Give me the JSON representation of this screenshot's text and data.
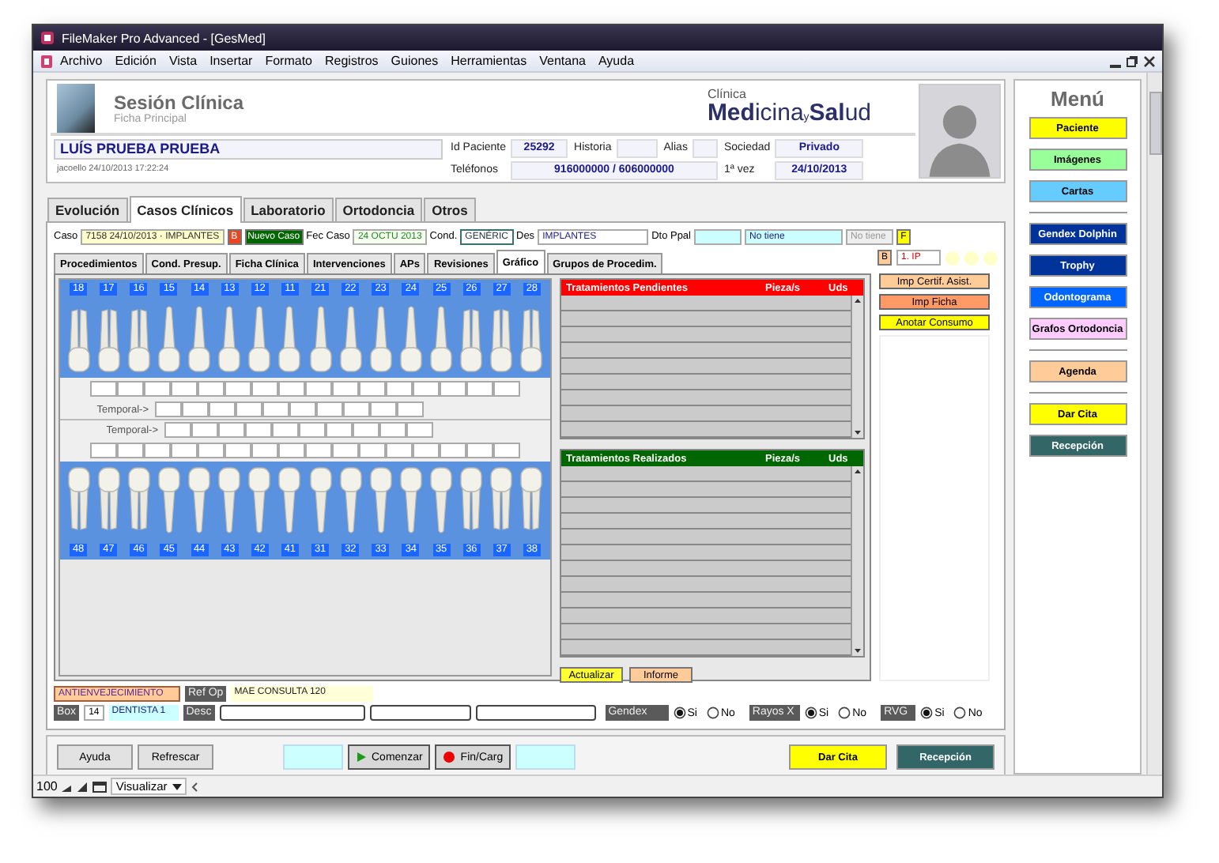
{
  "window": {
    "title": "FileMaker Pro Advanced - [GesMed]"
  },
  "menu_bar": [
    "Archivo",
    "Edición",
    "Vista",
    "Insertar",
    "Formato",
    "Registros",
    "Guiones",
    "Herramientas",
    "Ventana",
    "Ayuda"
  ],
  "header": {
    "title": "Sesión Clínica",
    "subtitle": "Ficha Principal",
    "clinic_label": "Clínica",
    "clinic_name": "**Med**icina$_{y}$**Sal**ud",
    "patient_name": "LUÍS PRUEBA PRUEBA",
    "audit": "jacoello 24/10/2013 17:22:24",
    "fields": [
      {
        "label": "Id Paciente",
        "value": "25292"
      },
      {
        "label": "Historia"
      },
      {
        "label": "Alias"
      },
      {
        "label": "Sociedad",
        "value": "Privado"
      },
      {
        "label": "Teléfonos",
        "value": "916000000 / 606000000"
      },
      {
        "label": "1ª vez",
        "value": "24/10/2013"
      }
    ]
  },
  "tabs": [
    {
      "label": "Evolución",
      "selected": false
    },
    {
      "label": "Casos Clínicos",
      "selected": true
    },
    {
      "label": "Laboratorio",
      "selected": false
    },
    {
      "label": "Ortodoncia",
      "selected": false
    },
    {
      "label": "Otros",
      "selected": false
    }
  ],
  "case": {
    "caso_label": "Caso",
    "caso": "7158 24/10/2013 · IMPLANTES",
    "b_button": "B",
    "new_case_button": "Nuevo Caso",
    "date_label": "Fec Caso",
    "date": "24 OCTU 2013",
    "cond_label": "Cond.",
    "cond": "GENÉRIC",
    "des_label": "Des",
    "des": "IMPLANTES",
    "dto_label": "Dto Ppal",
    "dto_value": "No tiene",
    "dto_status": "No tiene",
    "f_button": "F",
    "subtabs": [
      {
        "label": "Procedimientos",
        "selected": false
      },
      {
        "label": "Cond. Presup.",
        "selected": false
      },
      {
        "label": "Ficha Clínica",
        "selected": false
      },
      {
        "label": "Intervenciones",
        "selected": false
      },
      {
        "label": "APs",
        "selected": false
      },
      {
        "label": "Revisiones",
        "selected": false
      },
      {
        "label": "Gráfico",
        "selected": true
      },
      {
        "label": "Grupos de Procedim.",
        "selected": false
      }
    ],
    "flag_button": "B",
    "ip": "1. IP"
  },
  "odontogram": {
    "upper": [
      "18",
      "17",
      "16",
      "15",
      "14",
      "13",
      "12",
      "11",
      "21",
      "22",
      "23",
      "24",
      "25",
      "26",
      "27",
      "28"
    ],
    "lower": [
      "48",
      "47",
      "46",
      "45",
      "44",
      "43",
      "42",
      "41",
      "31",
      "32",
      "33",
      "34",
      "35",
      "36",
      "37",
      "38"
    ],
    "temporal_labels": [
      "Temporal->",
      "Temporal->"
    ]
  },
  "treatments": [
    {
      "kind": "pending",
      "title": "Tratamientos Pendientes",
      "columns": [
        "Pieza/s",
        "Uds"
      ]
    },
    {
      "kind": "done",
      "title": "Tratamientos Realizados",
      "columns": [
        "Pieza/s",
        "Uds"
      ]
    }
  ],
  "treatment_buttons": [
    {
      "label": "Actualizar",
      "color": "#ffff33"
    },
    {
      "label": "Informe",
      "color": "#ffcc99"
    }
  ],
  "action_buttons": [
    {
      "label": "Imp Certif. Asist.",
      "color": "#ffcc99"
    },
    {
      "label": "Imp Ficha",
      "color": "#ff9966"
    },
    {
      "label": "Anotar Consumo",
      "color": "#ffff00"
    }
  ],
  "bottom": {
    "program": "ANTIENVEJECIMIENTO",
    "ref_label": "Ref Op",
    "ref_value": "MAE CONSULTA 120",
    "box_label": "Box",
    "box_number": "14",
    "box_name": "DENTISTA 1",
    "desc_label": "Desc",
    "radio_groups": [
      {
        "label": "Gendex",
        "options": [
          {
            "label": "Si",
            "selected": true
          },
          {
            "label": "No",
            "selected": false
          }
        ]
      },
      {
        "label": "Rayos X",
        "options": [
          {
            "label": "Si",
            "selected": true
          },
          {
            "label": "No",
            "selected": false
          }
        ]
      },
      {
        "label": "RVG",
        "options": [
          {
            "label": "Si",
            "selected": true
          },
          {
            "label": "No",
            "selected": false
          }
        ]
      }
    ]
  },
  "footer": {
    "left": [
      {
        "kind": "plain",
        "label": "Ayuda"
      },
      {
        "kind": "plain",
        "label": "Refrescar"
      }
    ],
    "center": [
      {
        "kind": "blank"
      },
      {
        "kind": "play",
        "label": "Comenzar"
      },
      {
        "kind": "record",
        "label": "Fin/Carg"
      },
      {
        "kind": "blank"
      }
    ],
    "right": [
      {
        "kind": "color",
        "label": "Dar Cita",
        "color": "#ffff00"
      },
      {
        "kind": "color",
        "label": "Recepción",
        "color": "#336666"
      }
    ]
  },
  "side_menu": {
    "title": "Menú",
    "groups": [
      {
        "items": [
          {
            "label": "Paciente",
            "color": "#ffff00"
          },
          {
            "label": "Imágenes",
            "color": "#99ff99"
          },
          {
            "label": "Cartas",
            "color": "#66ccff"
          }
        ]
      },
      {
        "items": [
          {
            "label": "Gendex Dolphin",
            "color": "#003399"
          },
          {
            "label": "Trophy",
            "color": "#003399"
          },
          {
            "label": "Odontograma",
            "color": "#0066ff"
          },
          {
            "label": "Grafos Ortodoncia",
            "color": "#ffccff"
          }
        ]
      },
      {
        "items": [
          {
            "label": "Agenda",
            "color": "#ffcc99"
          }
        ]
      },
      {
        "items": [
          {
            "label": "Dar Cita",
            "color": "#ffff00"
          },
          {
            "label": "Recepción",
            "color": "#336666"
          }
        ]
      }
    ]
  },
  "status_bar": {
    "zoom": "100",
    "mode": "Visualizar"
  }
}
